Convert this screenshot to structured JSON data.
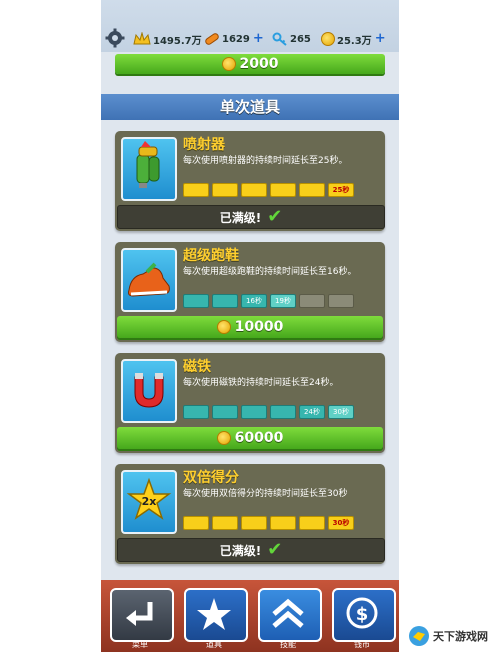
{
  "topbar": {
    "score": "1495.7万",
    "boards": "1629",
    "keys": "265",
    "coins": "25.3万"
  },
  "top_button": {
    "price": "2000"
  },
  "section_title": "单次道具",
  "items": [
    {
      "title": "喷射器",
      "desc": "每次使用喷射器的持续时间延长至25秒。",
      "segments": [
        "",
        "",
        "",
        "",
        "",
        "25秒"
      ],
      "action": "已满级!",
      "maxed": true
    },
    {
      "title": "超级跑鞋",
      "desc": "每次使用超级跑鞋的持续时间延长至16秒。",
      "segments": [
        "",
        "",
        "16秒",
        "19秒",
        "",
        ""
      ],
      "action": "10000",
      "maxed": false
    },
    {
      "title": "磁铁",
      "desc": "每次使用磁铁的持续时间延长至24秒。",
      "segments": [
        "",
        "",
        "",
        "",
        "24秒",
        "30秒"
      ],
      "action": "60000",
      "maxed": false
    },
    {
      "title": "双倍得分",
      "desc": "每次使用双倍得分的持续时间延长至30秒",
      "segments": [
        "",
        "",
        "",
        "",
        "",
        "30秒"
      ],
      "action": "已满级!",
      "maxed": true
    }
  ],
  "nav": {
    "menu": "菜单",
    "items": "道具",
    "skills": "技能",
    "coins": "钱币"
  },
  "watermark": "天下游戏网"
}
